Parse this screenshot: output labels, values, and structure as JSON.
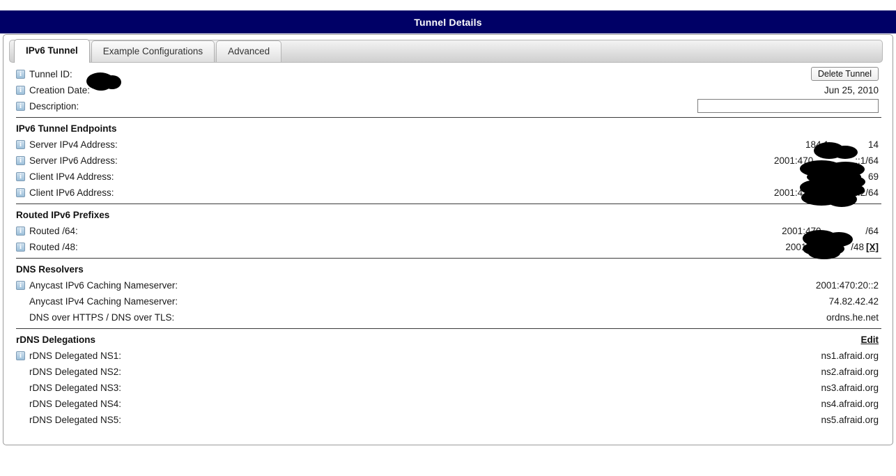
{
  "window": {
    "title": "Tunnel Details"
  },
  "tabs": [
    {
      "label": "IPv6 Tunnel",
      "active": true
    },
    {
      "label": "Example Configurations",
      "active": false
    },
    {
      "label": "Advanced",
      "active": false
    }
  ],
  "general": {
    "tunnel_id_label": "Tunnel ID:",
    "tunnel_id_value": "",
    "creation_date_label": "Creation Date:",
    "creation_date_value": "Jun 25, 2010",
    "description_label": "Description:",
    "description_value": "",
    "description_placeholder": "",
    "delete_button": "Delete Tunnel"
  },
  "endpoints": {
    "title": "IPv6 Tunnel Endpoints",
    "rows": [
      {
        "label": "Server IPv4 Address:",
        "value": "184.1               14"
      },
      {
        "label": "Server IPv6 Address:",
        "value": "2001:470                ::1/64"
      },
      {
        "label": "Client IPv4 Address:",
        "value": "69"
      },
      {
        "label": "Client IPv6 Address:",
        "value": "2001:470                ::2/64"
      }
    ]
  },
  "routed": {
    "title": "Routed IPv6 Prefixes",
    "rows": [
      {
        "label": "Routed /64:",
        "value": "2001:470                 /64",
        "action": ""
      },
      {
        "label": "Routed /48:",
        "value": "2001:470          /48",
        "action": "[X]"
      }
    ]
  },
  "dns": {
    "title": "DNS Resolvers",
    "rows": [
      {
        "label": "Anycast IPv6 Caching Nameserver:",
        "value": "2001:470:20::2",
        "icon": true
      },
      {
        "label": "Anycast IPv4 Caching Nameserver:",
        "value": "74.82.42.42",
        "icon": false
      },
      {
        "label": "DNS over HTTPS / DNS over TLS:",
        "value": "ordns.he.net",
        "icon": false
      }
    ]
  },
  "rdns": {
    "title": "rDNS Delegations",
    "edit_label": "Edit",
    "rows": [
      {
        "label": "rDNS Delegated NS1:",
        "value": "ns1.afraid.org",
        "icon": true
      },
      {
        "label": "rDNS Delegated NS2:",
        "value": "ns2.afraid.org",
        "icon": false
      },
      {
        "label": "rDNS Delegated NS3:",
        "value": "ns3.afraid.org",
        "icon": false
      },
      {
        "label": "rDNS Delegated NS4:",
        "value": "ns4.afraid.org",
        "icon": false
      },
      {
        "label": "rDNS Delegated NS5:",
        "value": "ns5.afraid.org",
        "icon": false
      }
    ]
  },
  "colors": {
    "titlebar_bg": "#000066",
    "titlebar_text": "#ffffff",
    "redaction": "#000000"
  }
}
